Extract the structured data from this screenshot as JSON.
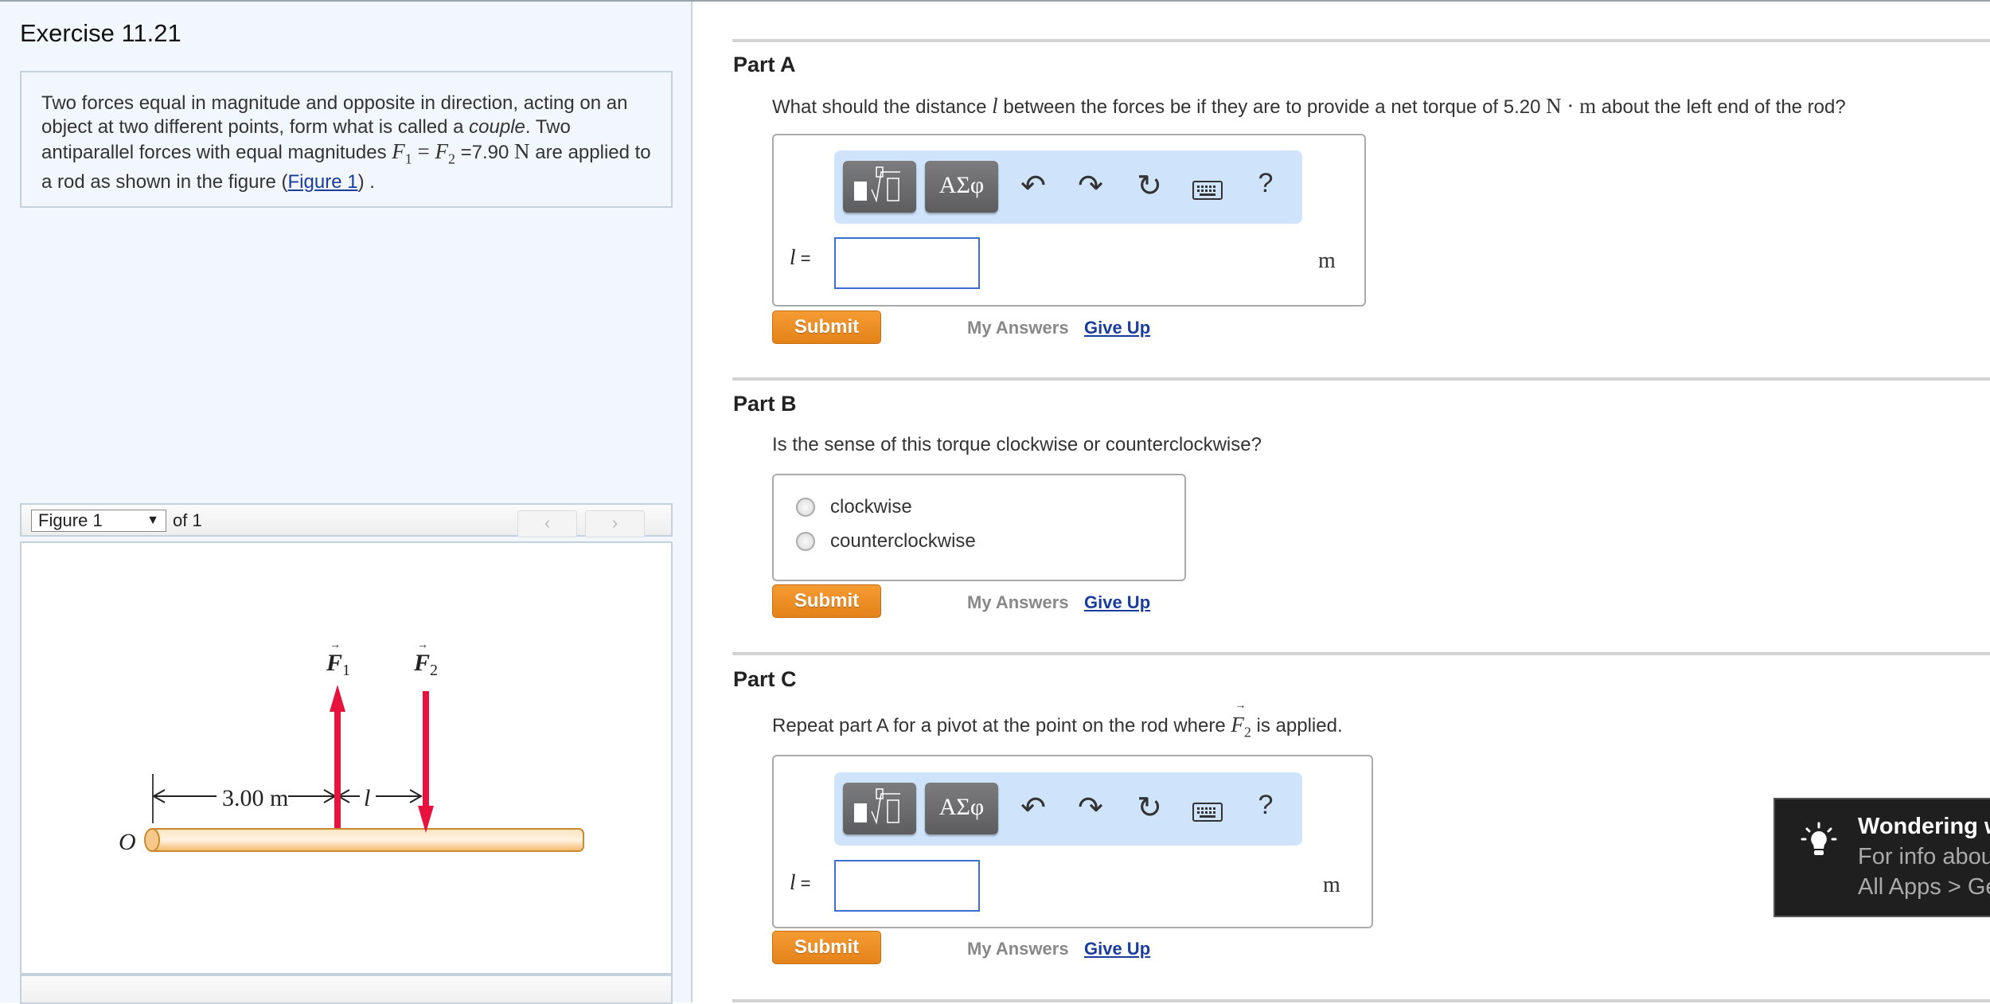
{
  "exercise": {
    "title": "Exercise 11.21",
    "intro": {
      "t1": "Two forces equal in magnitude and opposite in direction, acting on an object at two different points, form what is called a ",
      "t_em": "couple",
      "t2": ". Two antiparallel forces with equal magnitudes ",
      "f1": "F",
      "f1_sub": "1",
      "eq": " = ",
      "f2": "F",
      "f2_sub": "2",
      "eq2": " =7.90 ",
      "unit_N": "N",
      "t3": " are applied to a rod as shown in the figure (",
      "figure_link": "Figure 1",
      "t4": ") ."
    }
  },
  "figure_nav": {
    "selected": "Figure 1",
    "of_label": "of 1",
    "prev_label": "‹",
    "next_label": "›"
  },
  "figure": {
    "origin_label": "O",
    "distance_label": "3.00 m",
    "l_label": "l",
    "f1_label": "F",
    "f1_sub": "1",
    "f2_label": "F",
    "f2_sub": "2",
    "arrow_color": "#e8123f",
    "rod_color": "#f6c98a"
  },
  "parts": [
    {
      "title": "Part A",
      "question_pre": "What should the distance ",
      "question_var": "l",
      "question_mid": " between the forces be if they are to provide a net torque of 5.20 ",
      "question_unit": "N · m",
      "question_post": " about the left end of the rod?",
      "var_label": "l",
      "eq_sign": " =",
      "input_value": "",
      "unit": "m",
      "submit_label": "Submit",
      "my_answers_label": "My Answers",
      "give_up_label": "Give Up"
    },
    {
      "title": "Part B",
      "question": "Is the sense of this torque clockwise or counterclockwise?",
      "options": [
        {
          "label": "clockwise",
          "selected": false
        },
        {
          "label": "counterclockwise",
          "selected": false
        }
      ],
      "submit_label": "Submit",
      "my_answers_label": "My Answers",
      "give_up_label": "Give Up"
    },
    {
      "title": "Part C",
      "question_pre": "Repeat part A for a pivot at the point on the rod where ",
      "question_var": "F",
      "question_sub": "2",
      "question_post": " is applied.",
      "var_label": "l",
      "eq_sign": " =",
      "input_value": "",
      "unit": "m",
      "submit_label": "Submit",
      "my_answers_label": "My Answers",
      "give_up_label": "Give Up"
    }
  ],
  "toolbar": {
    "templates_label": "√",
    "symbols_label": "ΑΣφ",
    "undo_icon": "↶",
    "redo_icon": "↷",
    "reset_icon": "↻",
    "help_label": "?"
  },
  "toast": {
    "title": "Wondering w",
    "line1": "For info abou",
    "line2": "All Apps > Ge"
  }
}
